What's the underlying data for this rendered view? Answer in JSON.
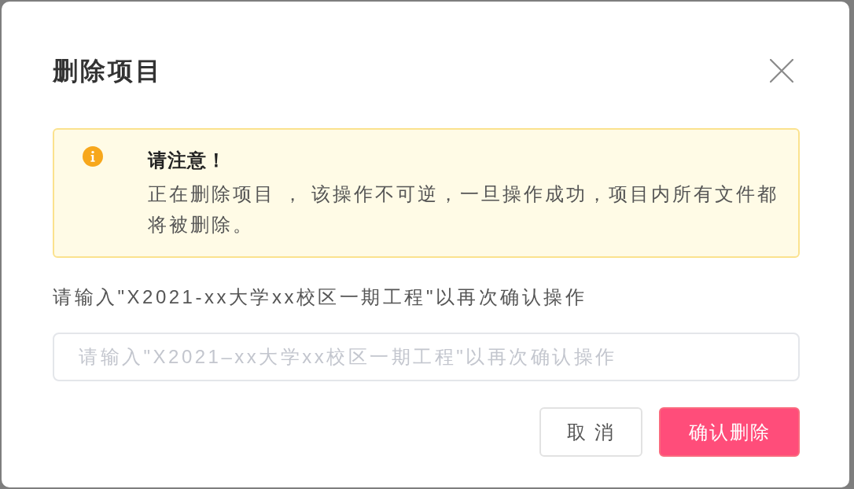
{
  "dialog": {
    "title": "删除项目",
    "alert": {
      "title": "请注意！",
      "message": "正在删除项目 ， 该操作不可逆，一旦操作成功，项目内所有文件都将被删除。"
    },
    "confirm_prompt": "请输入\"X2021-xx大学xx校区一期工程\"以再次确认操作",
    "input": {
      "placeholder": "请输入\"X2021–xx大学xx校区一期工程\"以再次确认操作"
    },
    "buttons": [
      {
        "label": "取 消",
        "kind": "secondary"
      },
      {
        "label": "确认删除",
        "kind": "danger"
      }
    ]
  }
}
